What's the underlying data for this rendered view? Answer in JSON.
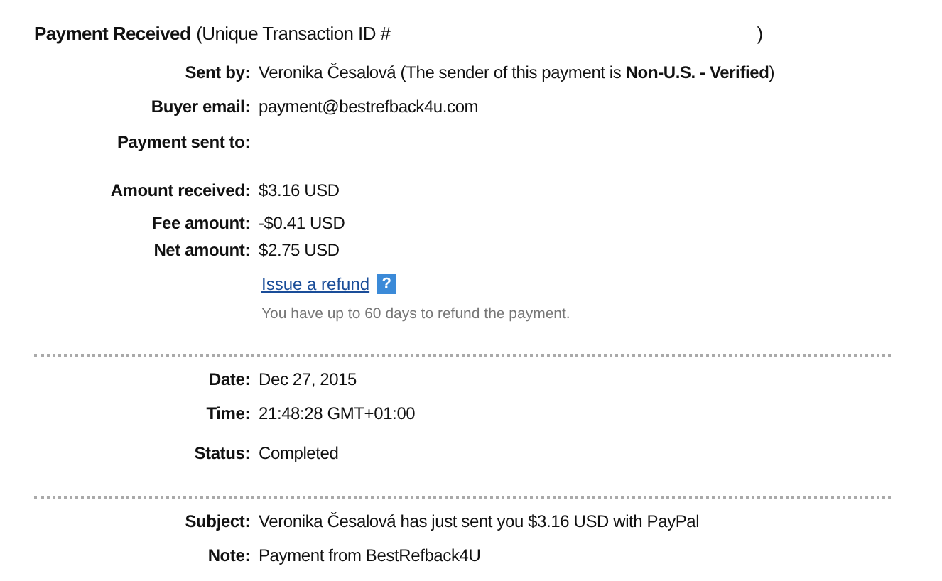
{
  "header": {
    "title": "Payment Received",
    "subtitle": "(Unique Transaction ID #",
    "close": ")"
  },
  "sections": [
    {
      "rows": [
        {
          "label": "Sent by:",
          "value": "Veronika Česalová (The sender of this payment is **Non-U.S. - Verified**)"
        },
        {
          "label": "Buyer email:",
          "value": "payment@bestrefback4u.com"
        },
        {
          "label": "Payment sent to:"
        },
        {
          "label": "Amount received:",
          "value": "$3.16 USD"
        },
        {
          "label": "Fee amount:",
          "value": "-$0.41 USD"
        },
        {
          "label": "Net amount:",
          "value": "$2.75 USD"
        }
      ],
      "refund": {
        "link": "Issue a refund",
        "help": "?",
        "note": "You have up to 60 days to refund the payment."
      }
    },
    {
      "rows": [
        {
          "label": "Date:",
          "value": "Dec 27, 2015"
        },
        {
          "label": "Time:",
          "value": "21:48:28 GMT+01:00"
        },
        {
          "label": "Status:",
          "value": "Completed"
        }
      ]
    },
    {
      "rows": [
        {
          "label": "Subject:",
          "value": "Veronika Česalová has just sent you $3.16 USD with PayPal"
        },
        {
          "label": "Note:",
          "value": "Payment from BestRefback4U"
        }
      ]
    }
  ]
}
